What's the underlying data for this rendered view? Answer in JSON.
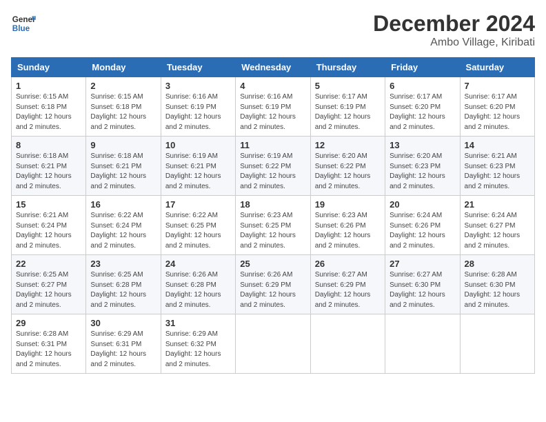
{
  "logo": {
    "general": "General",
    "blue": "Blue"
  },
  "title": {
    "month": "December 2024",
    "location": "Ambo Village, Kiribati"
  },
  "headers": [
    "Sunday",
    "Monday",
    "Tuesday",
    "Wednesday",
    "Thursday",
    "Friday",
    "Saturday"
  ],
  "weeks": [
    [
      {
        "day": "1",
        "sunrise": "6:15 AM",
        "sunset": "6:18 PM",
        "daylight": "12 hours and 2 minutes."
      },
      {
        "day": "2",
        "sunrise": "6:15 AM",
        "sunset": "6:18 PM",
        "daylight": "12 hours and 2 minutes."
      },
      {
        "day": "3",
        "sunrise": "6:16 AM",
        "sunset": "6:19 PM",
        "daylight": "12 hours and 2 minutes."
      },
      {
        "day": "4",
        "sunrise": "6:16 AM",
        "sunset": "6:19 PM",
        "daylight": "12 hours and 2 minutes."
      },
      {
        "day": "5",
        "sunrise": "6:17 AM",
        "sunset": "6:19 PM",
        "daylight": "12 hours and 2 minutes."
      },
      {
        "day": "6",
        "sunrise": "6:17 AM",
        "sunset": "6:20 PM",
        "daylight": "12 hours and 2 minutes."
      },
      {
        "day": "7",
        "sunrise": "6:17 AM",
        "sunset": "6:20 PM",
        "daylight": "12 hours and 2 minutes."
      }
    ],
    [
      {
        "day": "8",
        "sunrise": "6:18 AM",
        "sunset": "6:21 PM",
        "daylight": "12 hours and 2 minutes."
      },
      {
        "day": "9",
        "sunrise": "6:18 AM",
        "sunset": "6:21 PM",
        "daylight": "12 hours and 2 minutes."
      },
      {
        "day": "10",
        "sunrise": "6:19 AM",
        "sunset": "6:21 PM",
        "daylight": "12 hours and 2 minutes."
      },
      {
        "day": "11",
        "sunrise": "6:19 AM",
        "sunset": "6:22 PM",
        "daylight": "12 hours and 2 minutes."
      },
      {
        "day": "12",
        "sunrise": "6:20 AM",
        "sunset": "6:22 PM",
        "daylight": "12 hours and 2 minutes."
      },
      {
        "day": "13",
        "sunrise": "6:20 AM",
        "sunset": "6:23 PM",
        "daylight": "12 hours and 2 minutes."
      },
      {
        "day": "14",
        "sunrise": "6:21 AM",
        "sunset": "6:23 PM",
        "daylight": "12 hours and 2 minutes."
      }
    ],
    [
      {
        "day": "15",
        "sunrise": "6:21 AM",
        "sunset": "6:24 PM",
        "daylight": "12 hours and 2 minutes."
      },
      {
        "day": "16",
        "sunrise": "6:22 AM",
        "sunset": "6:24 PM",
        "daylight": "12 hours and 2 minutes."
      },
      {
        "day": "17",
        "sunrise": "6:22 AM",
        "sunset": "6:25 PM",
        "daylight": "12 hours and 2 minutes."
      },
      {
        "day": "18",
        "sunrise": "6:23 AM",
        "sunset": "6:25 PM",
        "daylight": "12 hours and 2 minutes."
      },
      {
        "day": "19",
        "sunrise": "6:23 AM",
        "sunset": "6:26 PM",
        "daylight": "12 hours and 2 minutes."
      },
      {
        "day": "20",
        "sunrise": "6:24 AM",
        "sunset": "6:26 PM",
        "daylight": "12 hours and 2 minutes."
      },
      {
        "day": "21",
        "sunrise": "6:24 AM",
        "sunset": "6:27 PM",
        "daylight": "12 hours and 2 minutes."
      }
    ],
    [
      {
        "day": "22",
        "sunrise": "6:25 AM",
        "sunset": "6:27 PM",
        "daylight": "12 hours and 2 minutes."
      },
      {
        "day": "23",
        "sunrise": "6:25 AM",
        "sunset": "6:28 PM",
        "daylight": "12 hours and 2 minutes."
      },
      {
        "day": "24",
        "sunrise": "6:26 AM",
        "sunset": "6:28 PM",
        "daylight": "12 hours and 2 minutes."
      },
      {
        "day": "25",
        "sunrise": "6:26 AM",
        "sunset": "6:29 PM",
        "daylight": "12 hours and 2 minutes."
      },
      {
        "day": "26",
        "sunrise": "6:27 AM",
        "sunset": "6:29 PM",
        "daylight": "12 hours and 2 minutes."
      },
      {
        "day": "27",
        "sunrise": "6:27 AM",
        "sunset": "6:30 PM",
        "daylight": "12 hours and 2 minutes."
      },
      {
        "day": "28",
        "sunrise": "6:28 AM",
        "sunset": "6:30 PM",
        "daylight": "12 hours and 2 minutes."
      }
    ],
    [
      {
        "day": "29",
        "sunrise": "6:28 AM",
        "sunset": "6:31 PM",
        "daylight": "12 hours and 2 minutes."
      },
      {
        "day": "30",
        "sunrise": "6:29 AM",
        "sunset": "6:31 PM",
        "daylight": "12 hours and 2 minutes."
      },
      {
        "day": "31",
        "sunrise": "6:29 AM",
        "sunset": "6:32 PM",
        "daylight": "12 hours and 2 minutes."
      },
      null,
      null,
      null,
      null
    ]
  ]
}
